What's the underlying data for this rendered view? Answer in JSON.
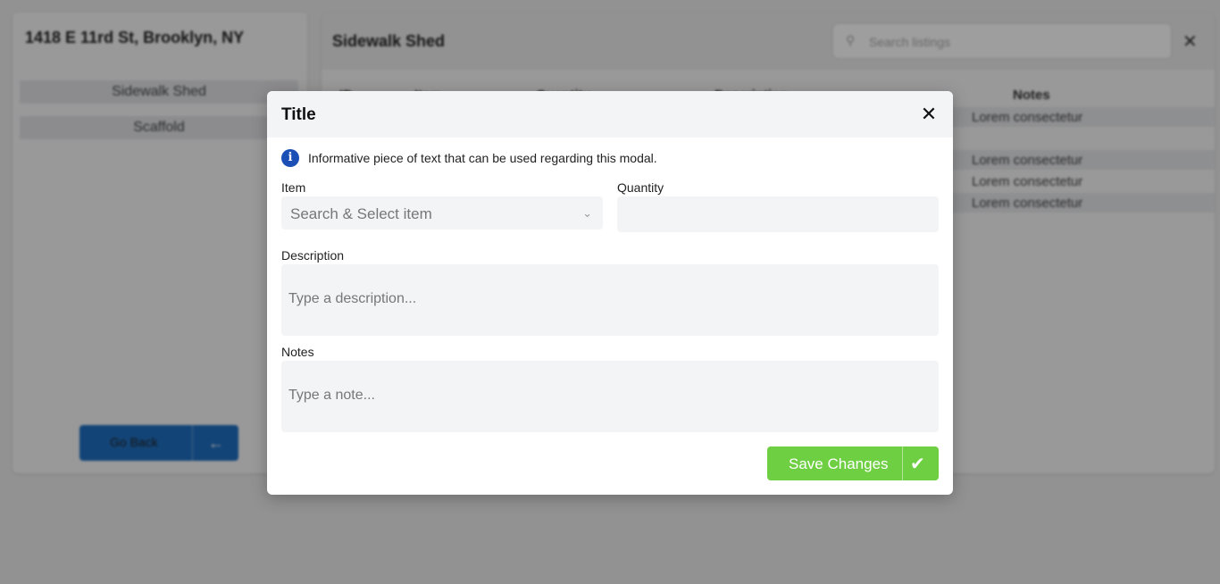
{
  "background": {
    "address": "1418 E 11rd St, Brooklyn, NY",
    "sidebar_items": [
      "Sidewalk Shed",
      "Scaffold"
    ],
    "go_back_label": "Go Back",
    "panel_title": "Sidewalk Shed",
    "search_placeholder": "Search listings",
    "table_headers": [
      "ID",
      "Item",
      "Quantity",
      "Description",
      "Notes"
    ],
    "row_note": "Lorem consectetur"
  },
  "modal": {
    "title": "Title",
    "info_text": "Informative piece of text that can be used regarding this modal.",
    "item_label": "Item",
    "item_placeholder": "Search & Select item",
    "quantity_label": "Quantity",
    "quantity_value": "",
    "description_label": "Description",
    "description_placeholder": "Type a description...",
    "notes_label": "Notes",
    "notes_placeholder": "Type a note...",
    "save_label": "Save Changes"
  },
  "colors": {
    "save_green": "#6fcf43",
    "info_blue": "#1b4fb5",
    "go_back_blue": "#1f6fc1"
  },
  "icons": {
    "info": "info-circle-icon",
    "close": "close-icon",
    "chevron": "chevron-down-icon",
    "check": "check-icon",
    "arrow_left": "arrow-left-icon",
    "search": "search-icon"
  }
}
